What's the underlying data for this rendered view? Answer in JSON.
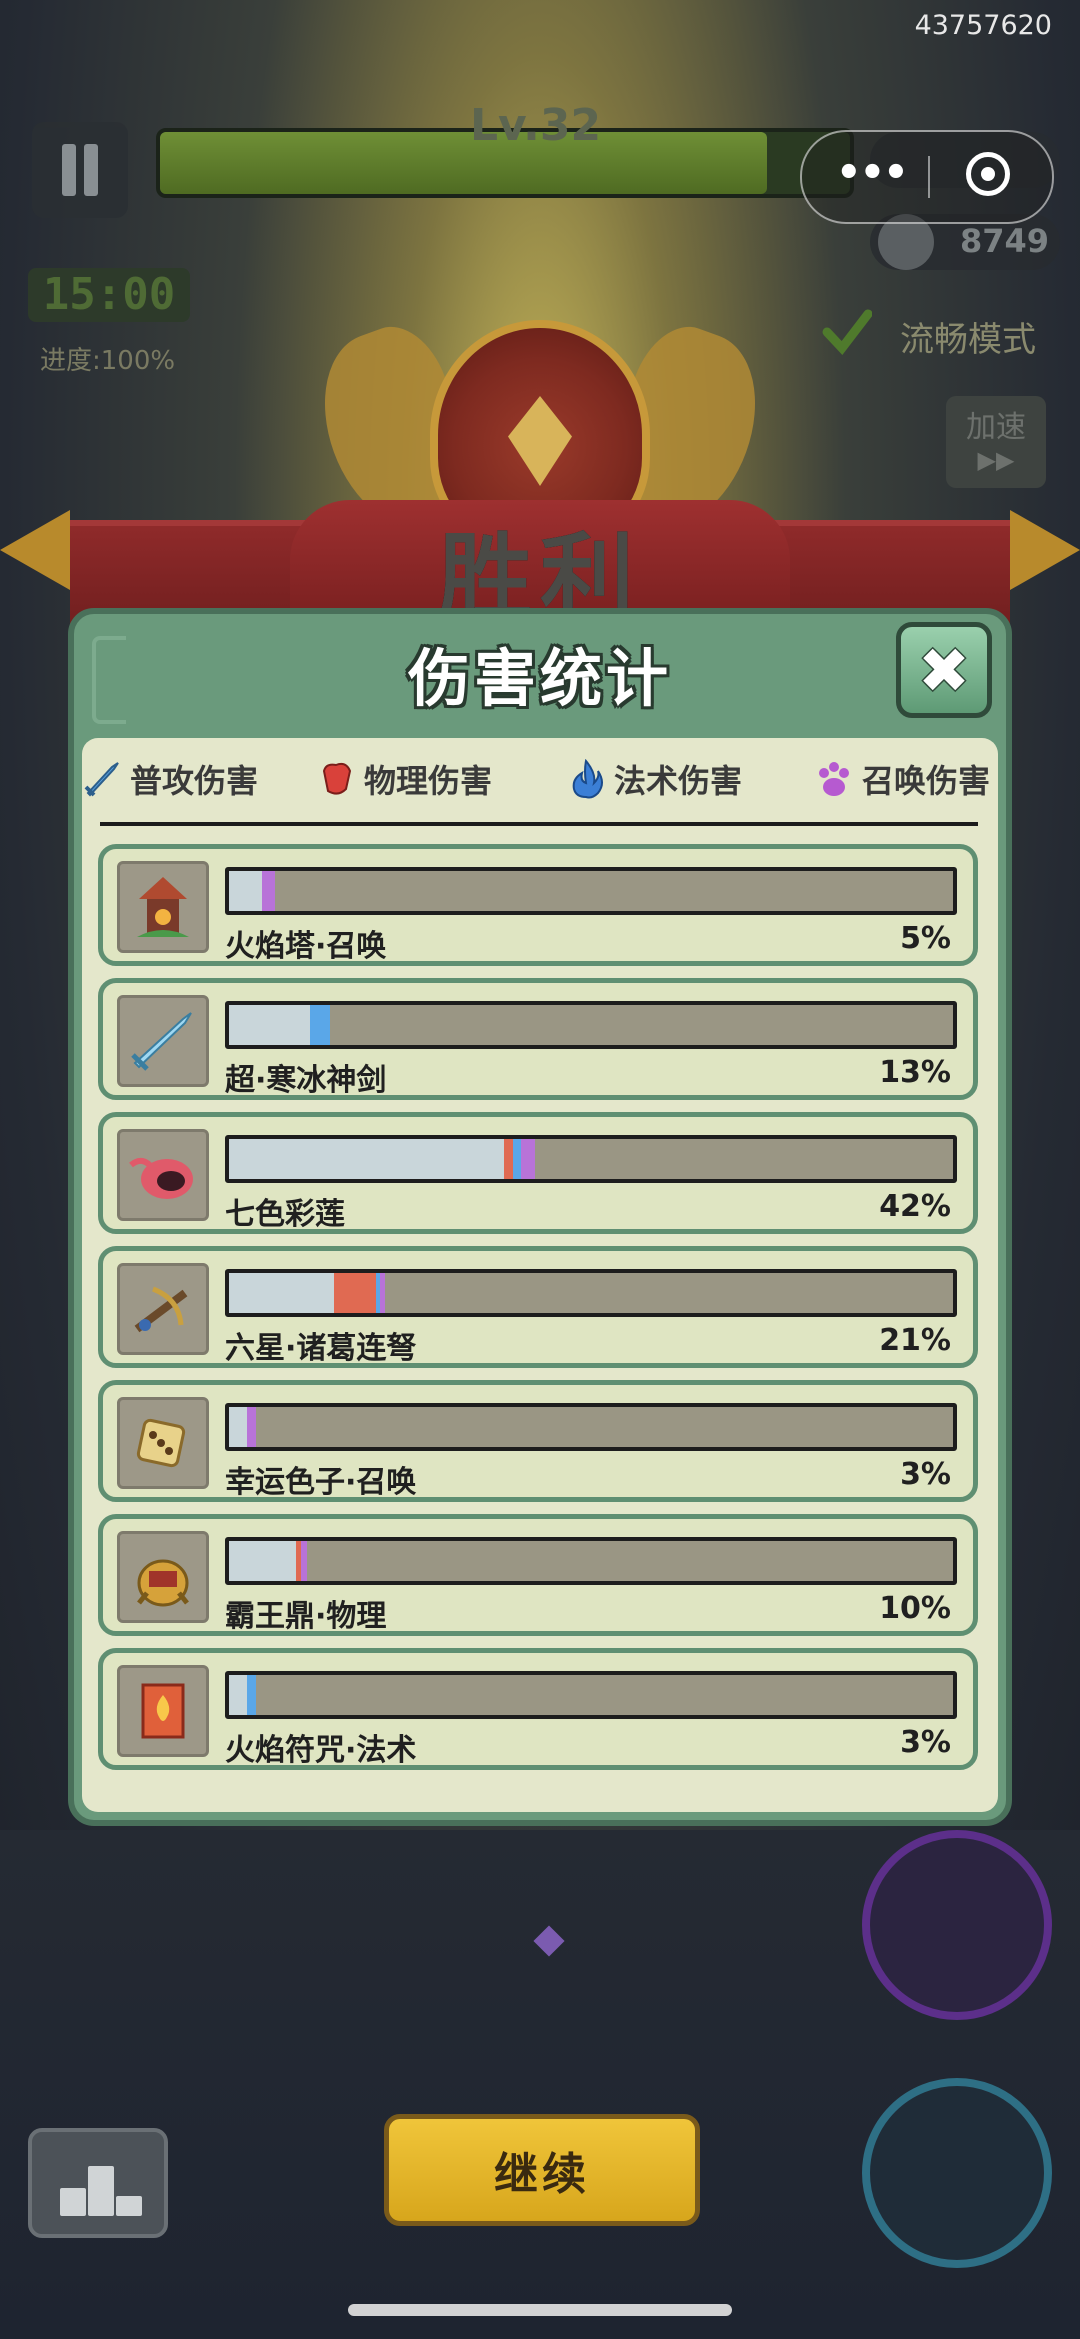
{
  "user_id": "43757620",
  "hud": {
    "level": "Lv.32",
    "kills": "8749",
    "timer": "15:00",
    "progress": "进度:100%",
    "smooth_mode": "流畅模式",
    "speed_label": "加速",
    "speed_arrows": "▶▶"
  },
  "capsule": {
    "more": "•••"
  },
  "victory": "胜利",
  "panel": {
    "title": "伤害统计",
    "close": "✖",
    "legend": [
      {
        "label": "普攻伤害",
        "icon": "sword-icon",
        "color": "#5aa3e0"
      },
      {
        "label": "物理伤害",
        "icon": "fist-icon",
        "color": "#d9413a"
      },
      {
        "label": "法术伤害",
        "icon": "flame-icon",
        "color": "#3b7fd6"
      },
      {
        "label": "召唤伤害",
        "icon": "paw-icon",
        "color": "#b65ad0"
      }
    ],
    "segment_colors": {
      "normal": "#c9d6da",
      "physical": "#e06a52",
      "magic": "#5aa7e8",
      "summon": "#b873d8"
    },
    "rows": [
      {
        "name": "火焰塔·召唤",
        "percent": "5%",
        "icon": "fire-tower-icon",
        "segments": {
          "normal": 0.045,
          "physical": 0,
          "magic": 0,
          "summon": 0.018
        }
      },
      {
        "name": "超·寒冰神剑",
        "percent": "13%",
        "icon": "ice-sword-icon",
        "segments": {
          "normal": 0.112,
          "physical": 0,
          "magic": 0.028,
          "summon": 0
        }
      },
      {
        "name": "七色彩莲",
        "percent": "42%",
        "icon": "lotus-icon",
        "segments": {
          "normal": 0.38,
          "physical": 0.012,
          "magic": 0.012,
          "summon": 0.018
        }
      },
      {
        "name": "六星·诸葛连弩",
        "percent": "21%",
        "icon": "crossbow-icon",
        "segments": {
          "normal": 0.145,
          "physical": 0.058,
          "magic": 0.006,
          "summon": 0.006
        }
      },
      {
        "name": "幸运色子·召唤",
        "percent": "3%",
        "icon": "dice-icon",
        "segments": {
          "normal": 0.025,
          "physical": 0,
          "magic": 0,
          "summon": 0.012
        }
      },
      {
        "name": "霸王鼎·物理",
        "percent": "10%",
        "icon": "cauldron-icon",
        "segments": {
          "normal": 0.092,
          "physical": 0.008,
          "magic": 0,
          "summon": 0.008
        }
      },
      {
        "name": "火焰符咒·法术",
        "percent": "3%",
        "icon": "fire-talisman-icon",
        "segments": {
          "normal": 0.025,
          "physical": 0,
          "magic": 0.012,
          "summon": 0
        }
      }
    ]
  },
  "continue_button": "继续"
}
